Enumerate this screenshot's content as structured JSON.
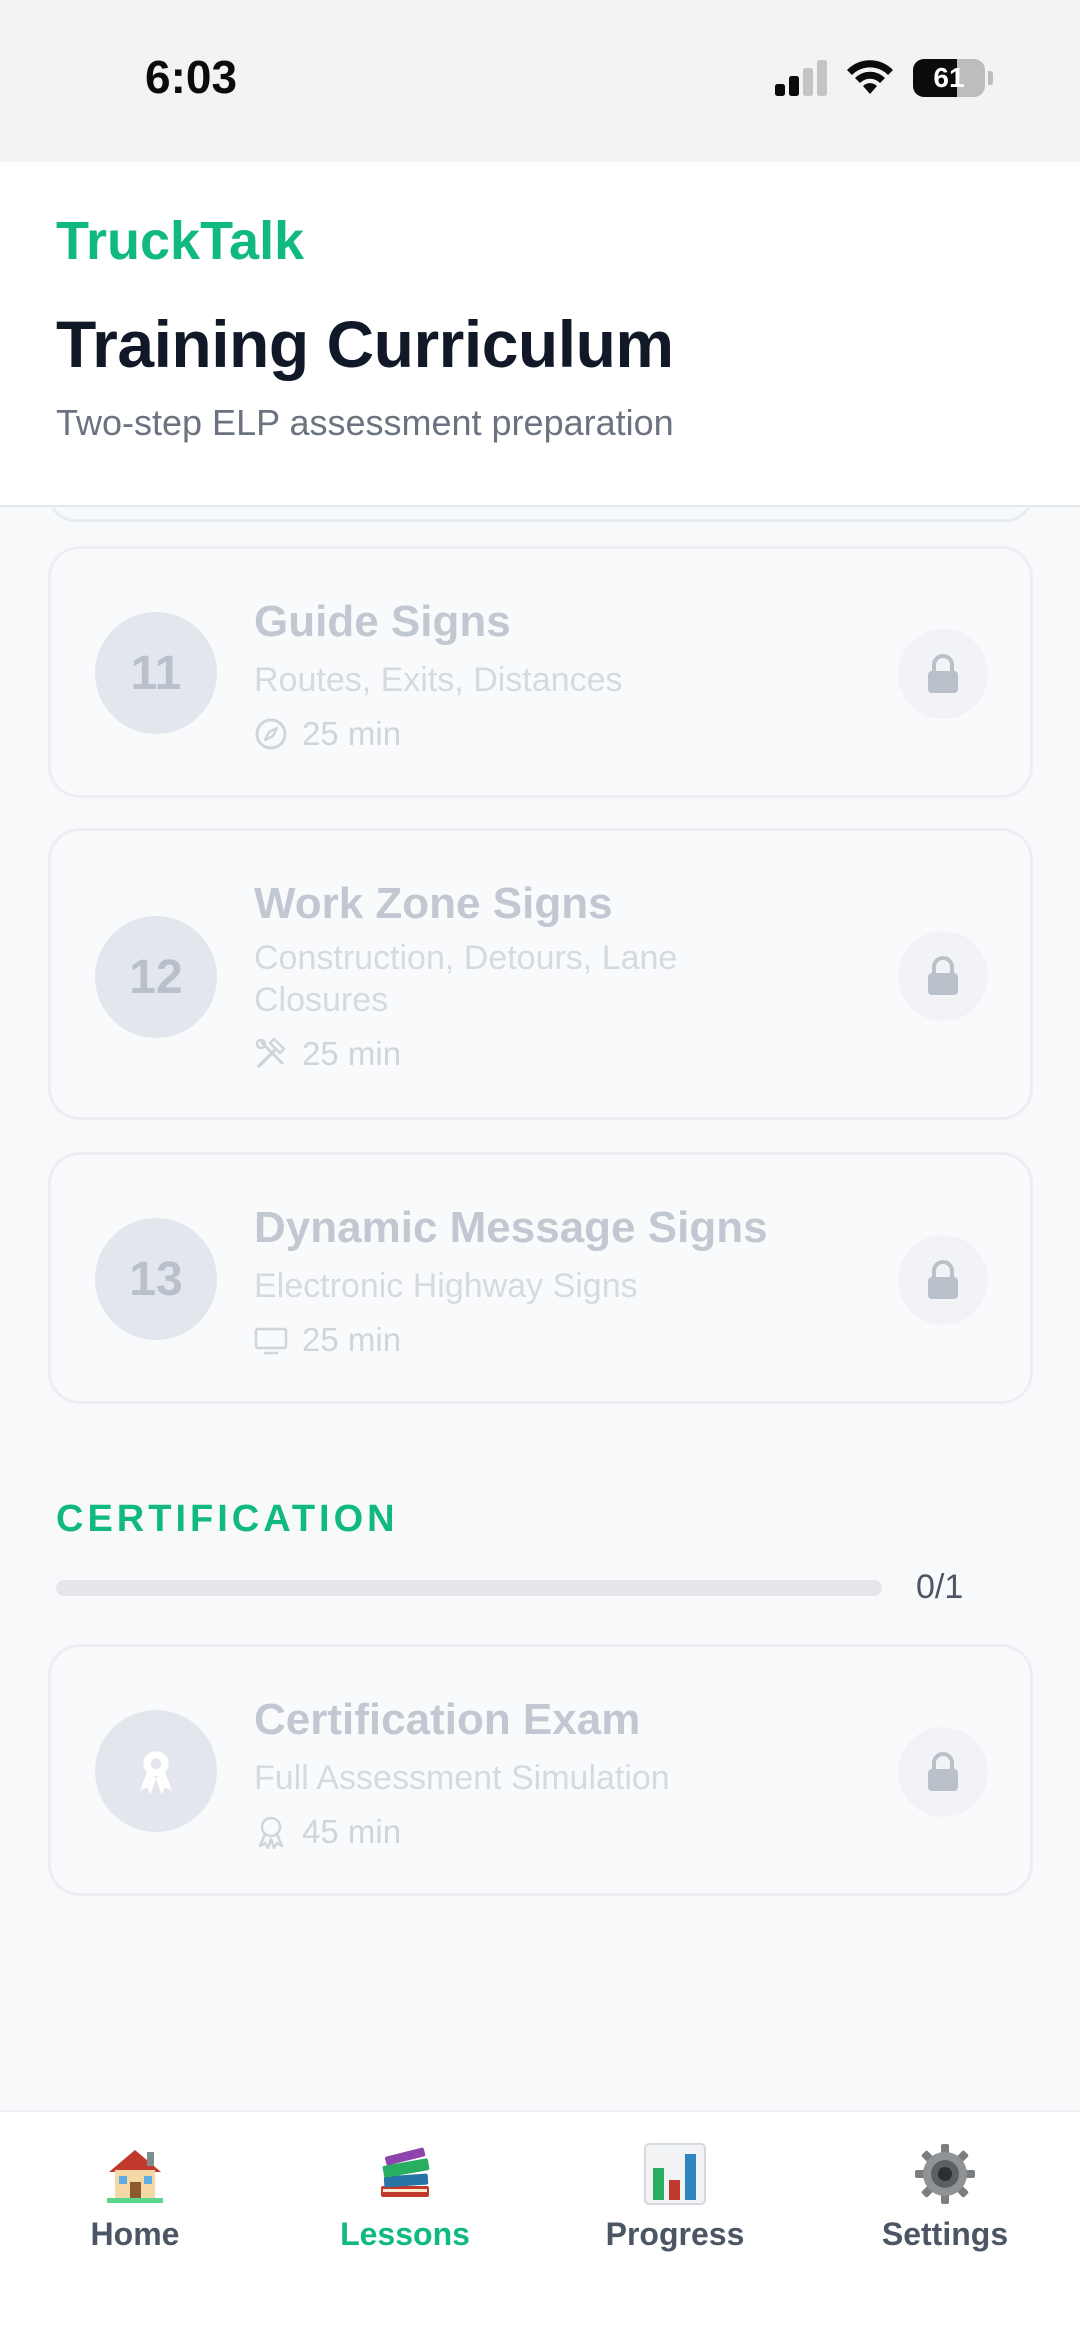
{
  "status_bar": {
    "time": "6:03",
    "battery": "61",
    "battery_level": 0.61
  },
  "header": {
    "brand": "TruckTalk",
    "title": "Training Curriculum",
    "subtitle": "Two-step ELP assessment preparation"
  },
  "lessons": [
    {
      "number": "11",
      "title": "Guide Signs",
      "subtitle": "Routes, Exits, Distances",
      "duration": "25 min",
      "icon": "compass-icon",
      "locked": true
    },
    {
      "number": "12",
      "title": "Work Zone Signs",
      "subtitle": "Construction, Detours, Lane Closures",
      "duration": "25 min",
      "icon": "tools-icon",
      "locked": true
    },
    {
      "number": "13",
      "title": "Dynamic Message Signs",
      "subtitle": "Electronic Highway Signs",
      "duration": "25 min",
      "icon": "monitor-icon",
      "locked": true
    }
  ],
  "certification": {
    "section_title": "CERTIFICATION",
    "progress_label": "0/1",
    "progress": 0,
    "exam": {
      "title": "Certification Exam",
      "subtitle": "Full Assessment Simulation",
      "duration": "45 min",
      "icon": "award-icon",
      "locked": true
    }
  },
  "tabs": [
    {
      "label": "Home",
      "icon": "house-icon",
      "active": false
    },
    {
      "label": "Lessons",
      "icon": "books-icon",
      "active": true
    },
    {
      "label": "Progress",
      "icon": "bar-chart-icon",
      "active": false
    },
    {
      "label": "Settings",
      "icon": "gear-icon",
      "active": false
    }
  ],
  "colors": {
    "accent": "#10b981",
    "locked_text": "#c2c8d2",
    "background": "#f8f9fb"
  }
}
